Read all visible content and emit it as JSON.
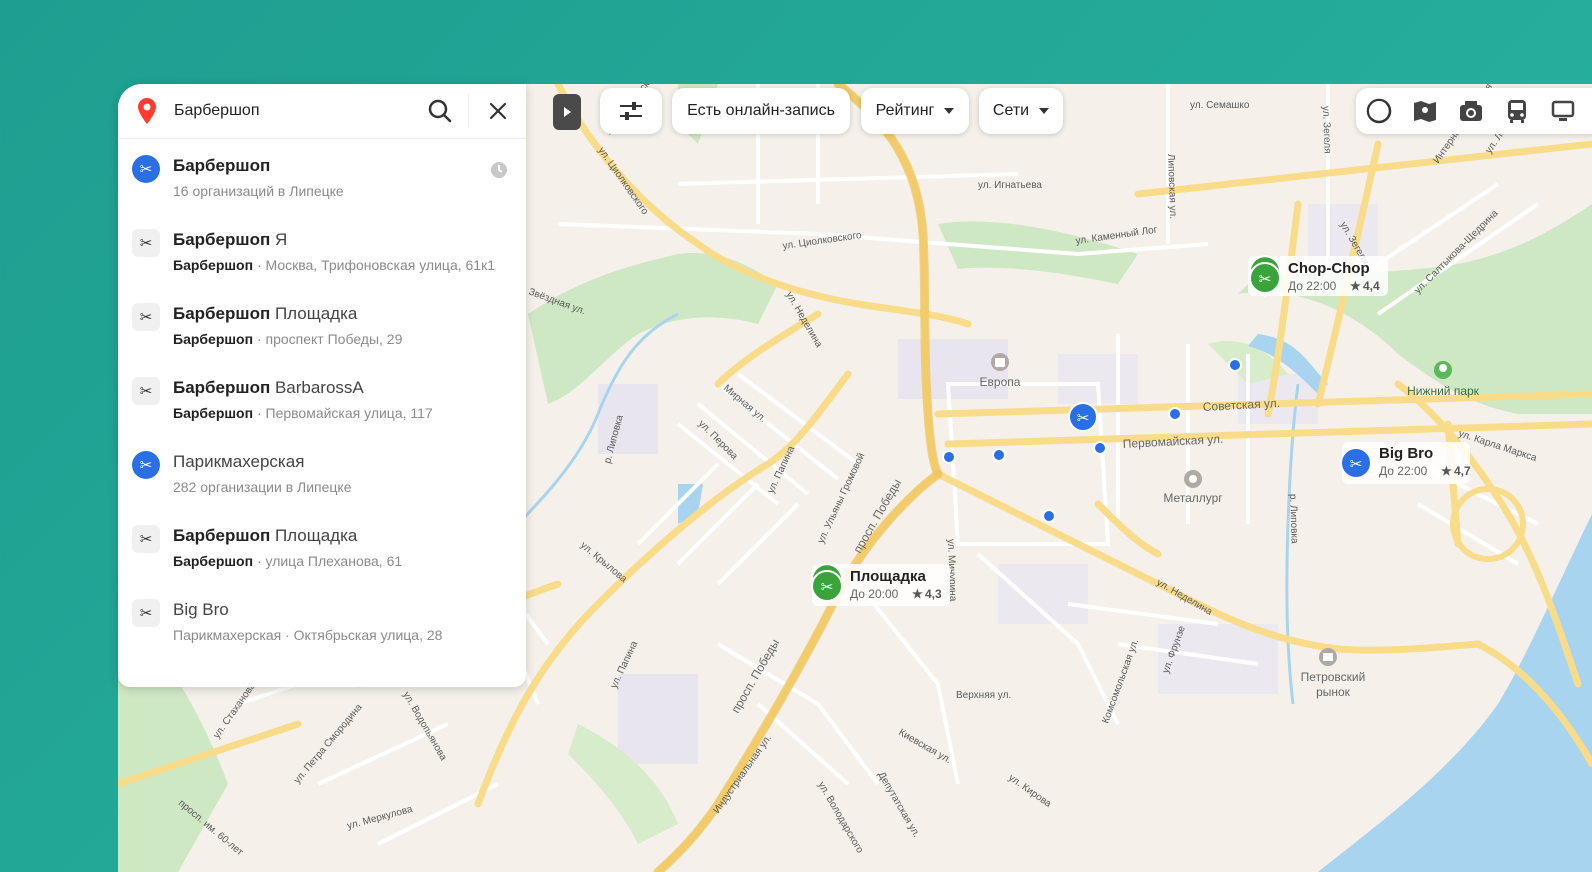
{
  "search": {
    "value": "Барбершоп",
    "placeholder": ""
  },
  "results": [
    {
      "title_bold": "Барбершоп",
      "title_rest": "",
      "category": "",
      "subtitle": "16 организаций в Липецке",
      "icon": "scissors-icon",
      "icon_style": "blue",
      "history": true
    },
    {
      "title_bold": "Барбершоп",
      "title_rest": " Я",
      "category": "Барбершоп",
      "subtitle": " · Москва, Трифоновская улица, 61к1",
      "icon": "scissors-icon",
      "icon_style": "grey",
      "history": false
    },
    {
      "title_bold": "Барбершоп",
      "title_rest": " Площадка",
      "category": "Барбершоп",
      "subtitle": " · проспект Победы, 29",
      "icon": "scissors-icon",
      "icon_style": "grey",
      "history": false
    },
    {
      "title_bold": "Барбершоп",
      "title_rest": " BarbarossA",
      "category": "Барбершоп",
      "subtitle": " · Первомайская улица, 117",
      "icon": "scissors-icon",
      "icon_style": "grey",
      "history": false
    },
    {
      "title_bold": "",
      "title_rest": "Парикмахерская",
      "category": "",
      "subtitle": "282 организации в Липецке",
      "icon": "scissors-icon",
      "icon_style": "blue",
      "history": false
    },
    {
      "title_bold": "Барбершоп",
      "title_rest": " Площадка",
      "category": "Барбершоп",
      "subtitle": " · улица Плеханова, 61",
      "icon": "scissors-icon",
      "icon_style": "grey",
      "history": false
    },
    {
      "title_bold": "",
      "title_rest": "Big Bro",
      "category": "",
      "subtitle": "Парикмахерская · Октябрьская улица, 28",
      "icon": "scissors-icon",
      "icon_style": "grey",
      "history": false
    }
  ],
  "toolbar": {
    "online_booking": "Есть онлайн-запись",
    "rating": "Рейтинг",
    "chains": "Сети"
  },
  "map": {
    "streets": {
      "semashko": "ул. Семашко",
      "tsiolkovskogo_1": "ул. Циолковского",
      "tsiolkovskogo_2": "ул. Циолковского",
      "ignatyeva": "ул. Игнатьева",
      "lipovskaya": "Липовская ул.",
      "zegelya_1": "ул. Зегеля",
      "zegelya_2": "ул. Зегеля",
      "internatsionalnaya": "Интернациональная",
      "lenina": "ул. Лени",
      "kamenny_log": "ул. Каменный Лог",
      "saltykova": "ул. Салтыкова-Щедрина",
      "zvezdnaya": "Звёздная ул.",
      "nedelina_1": "ул. Неделина",
      "nedelina_2": "ул. Неделина",
      "mirnaya": "Мирная ул.",
      "perova": "ул. Перова",
      "papina_1": "ул. Папина",
      "papina_2": "ул. Папина",
      "gromovoy": "ул. Ульяны Громовой",
      "pobedy_1": "просп. Победы",
      "pobedy_2": "просп. Победы",
      "sovetskaya": "Советская ул.",
      "pervomayskaya": "Первомайская ул.",
      "karla_marksa": "ул. Карла Маркса",
      "krylova": "ул. Крылова",
      "michurina": "ул. Мичурина",
      "stakhanova": "ул. Стаханова",
      "vodopyanova": "ул. Водопьянова",
      "smorodina": "ул. Петра Смородина",
      "merkulova": "ул. Меркулова",
      "60let": "просп. им. 60-лет",
      "industrialnaya": "Индустриальная ул.",
      "volodarskogo": "ул. Володарского",
      "deputatskaya": "Депутатская ул.",
      "kievskaya": "Киевская ул.",
      "kirova": "ул. Кирова",
      "komsomolskaya": "Комсомольская ул.",
      "verkhnyaya": "Верхняя ул.",
      "frunze": "ул. Фрунзе",
      "river": "р. Липовка"
    },
    "places": {
      "evropa": "Европа",
      "metallurg": "Металлург",
      "petrovsky_1": "Петровский",
      "petrovsky_2": "рынок",
      "park": "Нижний парк"
    },
    "pois": {
      "chopchop": {
        "name": "Chop-Chop",
        "hours": "До 22:00",
        "rating": "4,4",
        "color": "#3aa33a"
      },
      "bigbro": {
        "name": "Big Bro",
        "hours": "До 22:00",
        "rating": "4,7",
        "color": "#2a6fe6"
      },
      "ploshchadka": {
        "name": "Площадка",
        "hours": "До 20:00",
        "rating": "4,3",
        "color": "#3aa33a"
      }
    }
  },
  "colors": {
    "accent": "#2a6fe6",
    "green_pin": "#3aa33a",
    "background": "#1e9e90"
  }
}
